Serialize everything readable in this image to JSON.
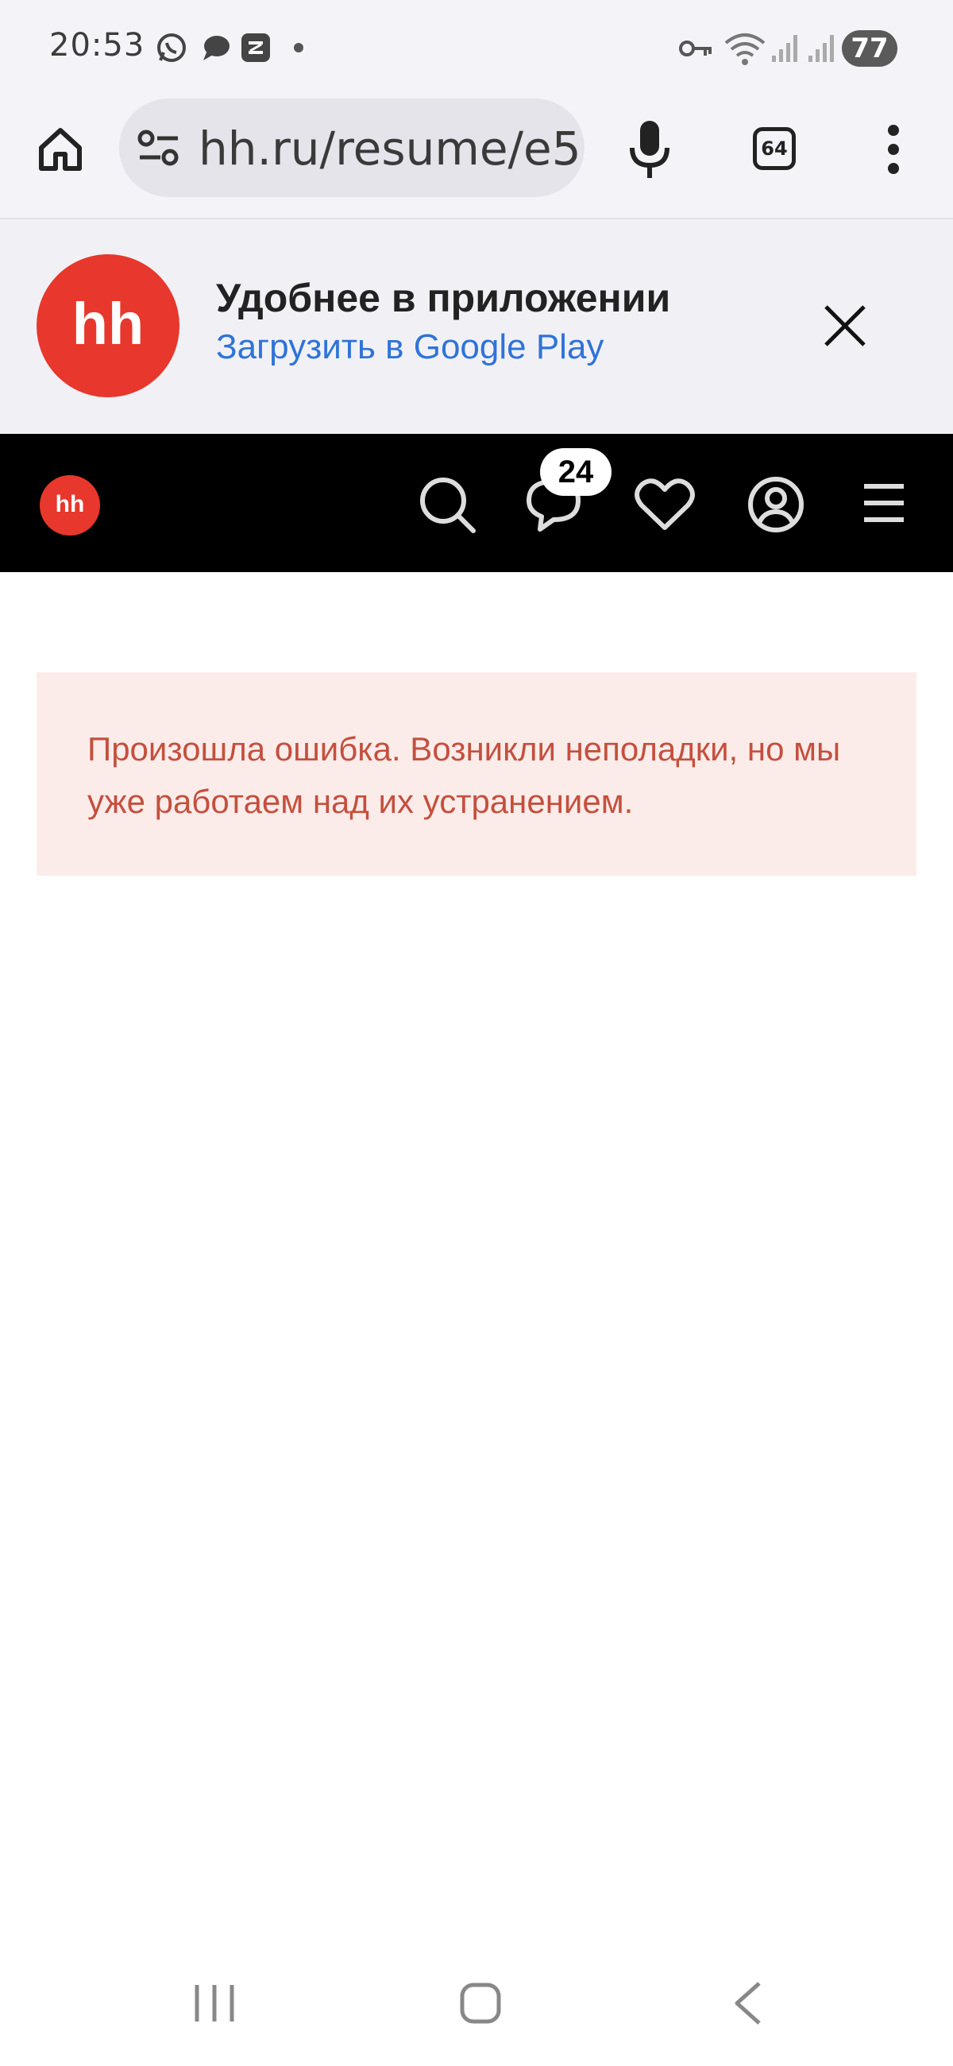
{
  "status_bar": {
    "time": "20:53",
    "notification_icons": [
      "whatsapp-icon",
      "chat-bubble-icon",
      "app-notification-icon"
    ],
    "system_icons": [
      "vpn-key-icon",
      "wifi-icon",
      "signal-icon",
      "signal-icon"
    ],
    "battery": "77"
  },
  "browser": {
    "url": "hh.ru/resume/e5",
    "tabs_count": "64"
  },
  "app_banner": {
    "logo_text": "hh",
    "title": "Удобнее в приложении",
    "link": "Загрузить в Google Play"
  },
  "site_header": {
    "logo_text": "hh",
    "messages_badge": "24"
  },
  "error": {
    "message": "Произошла ошибка. Возникли неполадки, но мы уже работаем над их устранением."
  },
  "colors": {
    "brand_red": "#e8372c",
    "link_blue": "#2f73d9",
    "error_text": "#c4503d",
    "error_bg": "#fbecea"
  }
}
